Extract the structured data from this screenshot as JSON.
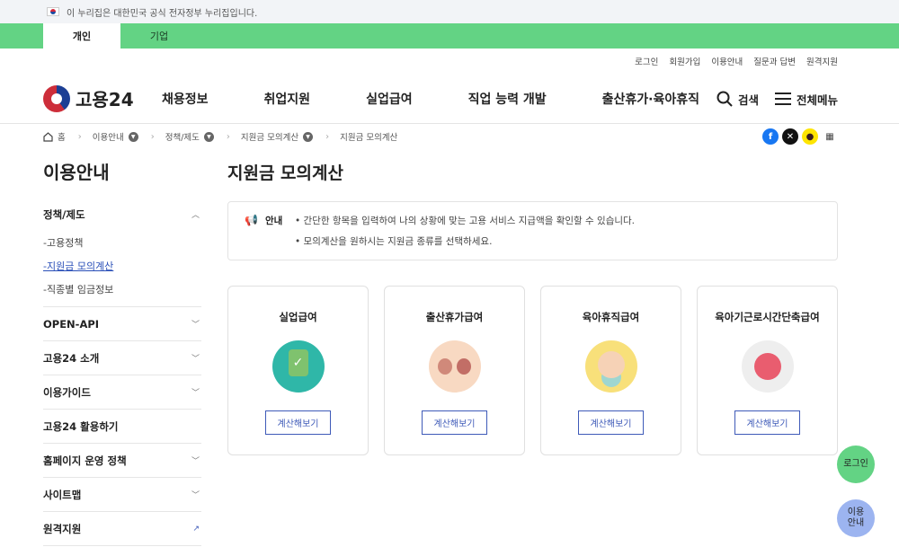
{
  "gov_banner": {
    "text": "이 누리집은 대한민국 공식 전자정부 누리집입니다."
  },
  "user_type_tabs": [
    {
      "label": "개인",
      "active": true
    },
    {
      "label": "기업",
      "active": false
    }
  ],
  "utility_links": [
    "로그인",
    "회원가입",
    "이용안내",
    "질문과 답변",
    "원격지원"
  ],
  "logo": {
    "text": "고용24"
  },
  "main_menu": [
    "채용정보",
    "취업지원",
    "실업급여",
    "직업 능력 개발",
    "출산휴가·육아휴직"
  ],
  "header_actions": {
    "search": "검색",
    "all_menu": "전체메뉴"
  },
  "breadcrumb": [
    "홈",
    "이용안내",
    "정책/제도",
    "지원금 모의계산",
    "지원금 모의계산"
  ],
  "share_icons": [
    "facebook-icon",
    "x-icon",
    "kakaotalk-icon",
    "print-icon"
  ],
  "sidebar": {
    "title": "이용안내",
    "groups": [
      {
        "label": "정책/제도",
        "expanded": true,
        "items": [
          "-고용정책",
          "-지원금 모의계산",
          "-직종별 임금정보"
        ],
        "active_item": 1
      },
      {
        "label": "OPEN-API"
      },
      {
        "label": "고용24 소개"
      },
      {
        "label": "이용가이드"
      },
      {
        "label": "고용24 활용하기"
      },
      {
        "label": "홈페이지 운영 정책"
      },
      {
        "label": "사이트맵"
      },
      {
        "label": "원격지원"
      }
    ]
  },
  "page_title": "지원금 모의계산",
  "notice": {
    "label": "안내",
    "lines": [
      "• 간단한 항목을 입력하여 나의 상황에 맞는 고용 서비스 지급액을 확인할 수 있습니다.",
      "• 모의계산을 원하시는 지원금 종류를 선택하세요."
    ]
  },
  "cards": [
    {
      "title": "실업급여",
      "button": "계산해보기",
      "icon": "phone-check-icon"
    },
    {
      "title": "출산휴가급여",
      "button": "계산해보기",
      "icon": "parents-icon"
    },
    {
      "title": "육아휴직급여",
      "button": "계산해보기",
      "icon": "baby-icon"
    },
    {
      "title": "육아기근로시간단축급여",
      "button": "계산해보기",
      "icon": "clock-icon"
    }
  ],
  "floating": {
    "login": "로그인",
    "guide_line1": "이용",
    "guide_line2": "안내"
  },
  "colors": {
    "brand_green": "#63d384",
    "link_blue": "#3e5ab8",
    "guide_blue": "#9cb4f0"
  }
}
